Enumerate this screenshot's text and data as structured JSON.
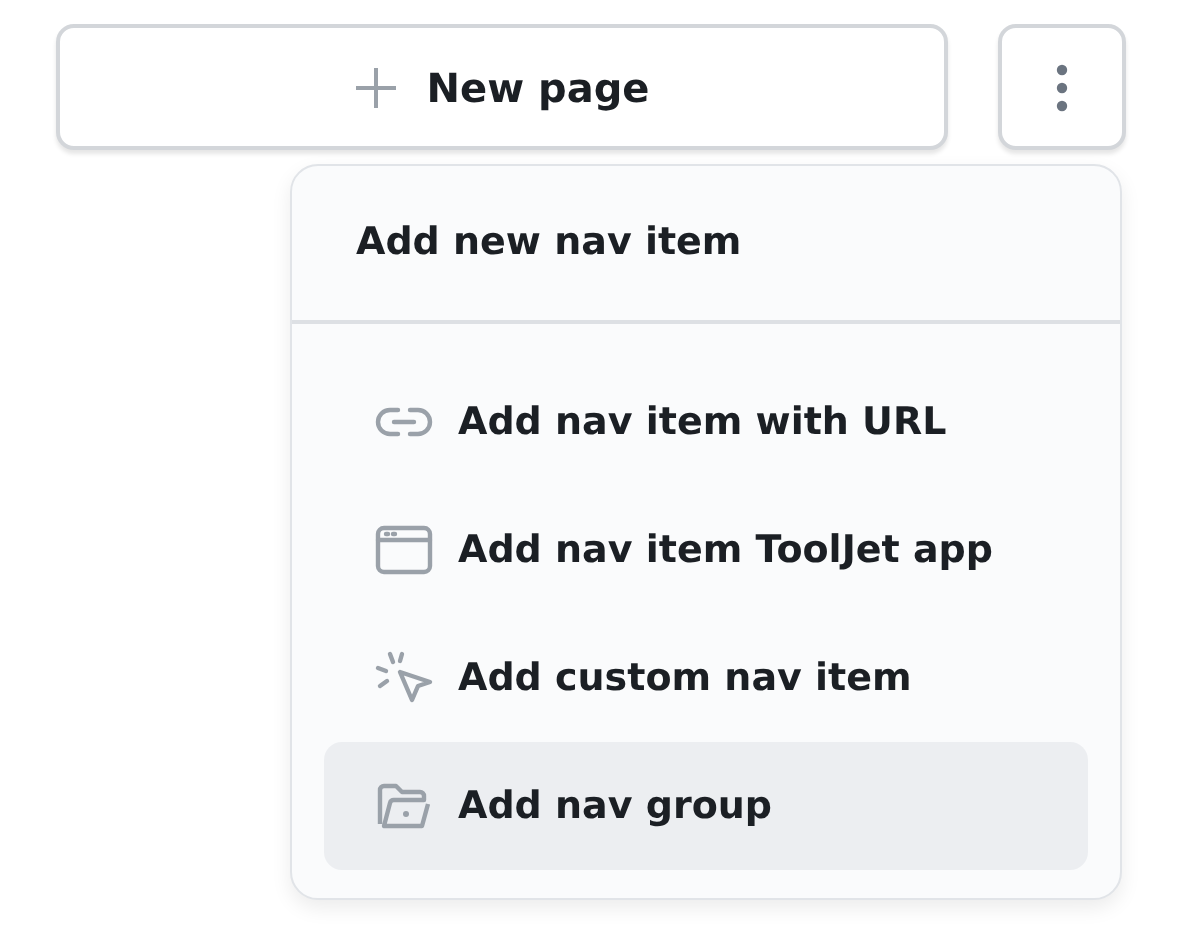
{
  "new_page_button": {
    "label": "New page"
  },
  "menu": {
    "header": "Add new nav item",
    "items": [
      {
        "kind": "link",
        "label": "Add nav item with URL",
        "selected": false
      },
      {
        "kind": "app",
        "label": "Add nav item ToolJet app",
        "selected": false
      },
      {
        "kind": "custom",
        "label": "Add custom nav item",
        "selected": false
      },
      {
        "kind": "group",
        "label": "Add nav group",
        "selected": true
      }
    ]
  }
}
